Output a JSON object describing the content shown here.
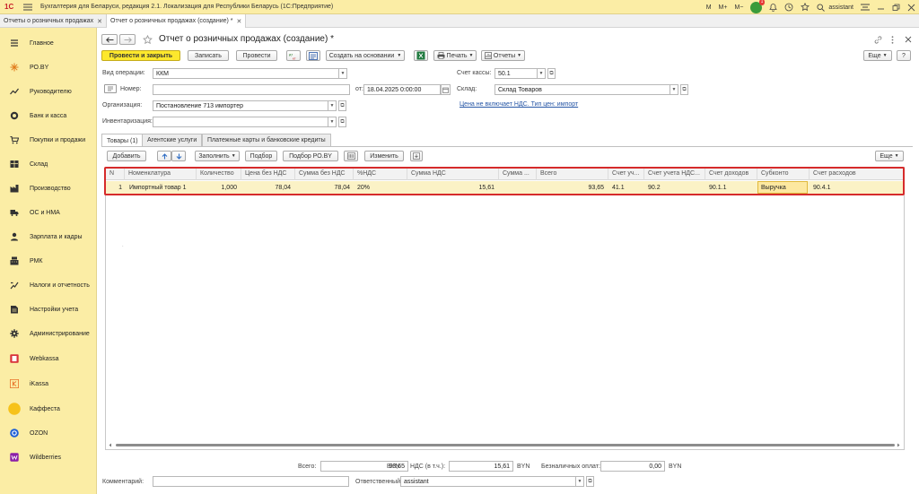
{
  "titlebar": {
    "logo": "1С",
    "title": "Бухгалтерия для Беларуси, редакция 2.1. Локализация для Республики Беларусь   (1С:Предприятие)",
    "m": "M",
    "mplus": "M+",
    "mminus": "M−",
    "badge": "1",
    "user": "assistant"
  },
  "tabs": [
    {
      "label": "Отчеты о розничных продажах"
    },
    {
      "label": "Отчет о розничных продажах (создание) *"
    }
  ],
  "sidebar": {
    "items": [
      {
        "label": "Главное",
        "icon": "menu-icon"
      },
      {
        "label": "РО.BY",
        "icon": "ro-by-icon"
      },
      {
        "label": "Руководителю",
        "icon": "chart-trend-icon"
      },
      {
        "label": "Банк и касса",
        "icon": "coin-icon"
      },
      {
        "label": "Покупки и продажи",
        "icon": "cart-icon"
      },
      {
        "label": "Склад",
        "icon": "warehouse-icon"
      },
      {
        "label": "Производство",
        "icon": "factory-icon"
      },
      {
        "label": "ОС и НМА",
        "icon": "truck-icon"
      },
      {
        "label": "Зарплата и кадры",
        "icon": "person-icon"
      },
      {
        "label": "РМК",
        "icon": "cash-register-icon"
      },
      {
        "label": "Налоги и отчетность",
        "icon": "percent-icon"
      },
      {
        "label": "Настройки учета",
        "icon": "book-icon"
      },
      {
        "label": "Администрирование",
        "icon": "gear-icon"
      },
      {
        "label": "Webkassa",
        "icon": "webkassa-icon"
      },
      {
        "label": "iKassa",
        "icon": "ikassa-icon"
      },
      {
        "label": "Каффеста",
        "icon": "kaffesta-icon"
      },
      {
        "label": "OZON",
        "icon": "ozon-icon"
      },
      {
        "label": "Wildberries",
        "icon": "wildberries-icon"
      }
    ]
  },
  "form": {
    "title": "Отчет о розничных продажах (создание) *",
    "toolbar": {
      "post_close": "Провести и закрыть",
      "save": "Записать",
      "post": "Провести",
      "create_based": "Создать на основании",
      "print": "Печать",
      "reports": "Отчеты",
      "more": "Еще",
      "help": "?"
    },
    "fields": {
      "op_type_label": "Вид операции:",
      "op_type_value": "ККМ",
      "number_label": "Номер:",
      "number_value": "",
      "date_label": "от:",
      "date_value": "18.04.2025  0:00:00",
      "org_label": "Организация:",
      "org_value": "Постановление 713 импортер",
      "inventory_label": "Инвентаризация:",
      "inventory_value": "",
      "cash_account_label": "Счет кассы:",
      "cash_account_value": "50.1",
      "warehouse_label": "Склад:",
      "warehouse_value": "Склад Товаров",
      "price_link": "Цена не включает НДС. Тип цен: импорт"
    },
    "tabs": [
      "Товары (1)",
      "Агентские услуги",
      "Платежные карты и банковские кредиты"
    ],
    "grid_toolbar": {
      "add": "Добавить",
      "fill": "Заполнить",
      "pick": "Подбор",
      "pick_ro": "Подбор РО.BY",
      "change": "Изменить",
      "more": "Еще"
    },
    "grid": {
      "columns": [
        "N",
        "Номенклатура",
        "Количество",
        "Цена без НДС",
        "Сумма без НДС",
        "%НДС",
        "Сумма НДС",
        "Сумма ...",
        "Всего",
        "Счет уч...",
        "Счет учета НДС...",
        "Счет доходов",
        "Субконто",
        "Счет расходов"
      ],
      "row": {
        "n": "1",
        "item": "Импортный товар 1",
        "qty": "1,000",
        "price": "78,04",
        "sum_net": "78,04",
        "vat_rate": "20%",
        "vat_sum": "15,61",
        "sum_other": "",
        "total": "93,65",
        "account": "41.1",
        "vat_account": "90.2",
        "income_account": "90.1.1",
        "subconto": "Выручка",
        "expense_account": "90.4.1"
      }
    },
    "totals": {
      "total_label": "Всего:",
      "total_value": "93,65",
      "currency1": "BYN",
      "vat_label": "НДС (в т.ч.):",
      "vat_value": "15,61",
      "currency2": "BYN",
      "cashless_label": "Безналичных оплат:",
      "cashless_value": "0,00",
      "currency3": "BYN"
    },
    "comment_label": "Комментарий:",
    "comment_value": "",
    "responsible_label": "Ответственный:",
    "responsible_value": "assistant"
  },
  "colors": {
    "sidebar_bg": "#fbeda5",
    "primary_button": "#fde82d",
    "selected_row": "#fbf2c6",
    "highlight_border": "#d62b2b",
    "link": "#2656a6"
  }
}
